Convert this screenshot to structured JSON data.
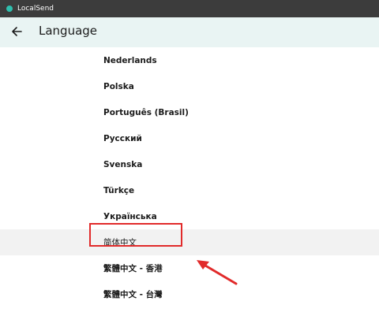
{
  "window": {
    "title": "LocalSend",
    "accent": "#2fbfae"
  },
  "appbar": {
    "title": "Language",
    "back_icon": "arrow-left-icon",
    "background": "#e9f4f3"
  },
  "languages": [
    {
      "label": "Nederlands",
      "selected": false
    },
    {
      "label": "Polska",
      "selected": false
    },
    {
      "label": "Português (Brasil)",
      "selected": false
    },
    {
      "label": "Русский",
      "selected": false
    },
    {
      "label": "Svenska",
      "selected": false
    },
    {
      "label": "Türkçe",
      "selected": false
    },
    {
      "label": "Українська",
      "selected": false
    },
    {
      "label": "简体中文",
      "selected": true
    },
    {
      "label": "繁體中文 - 香港",
      "selected": false
    },
    {
      "label": "繁體中文 - 台灣",
      "selected": false
    }
  ],
  "annotation": {
    "highlight_color": "#e12a2a",
    "arrow_color": "#e12a2a"
  }
}
